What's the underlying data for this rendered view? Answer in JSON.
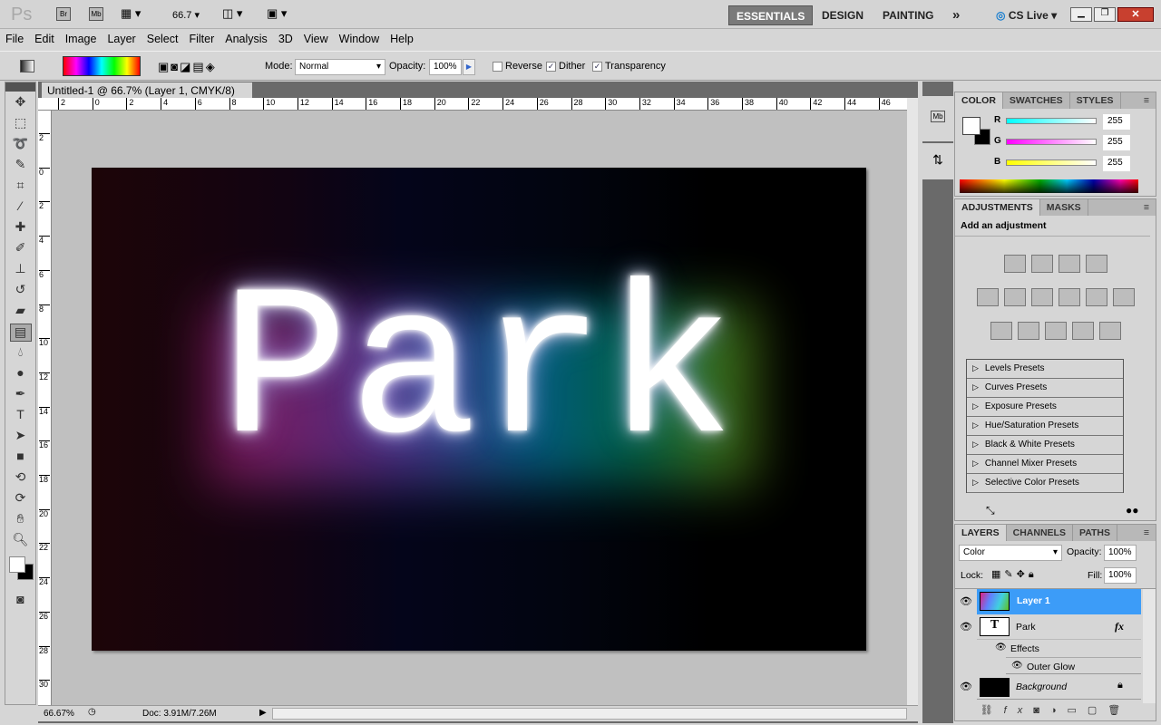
{
  "appbar": {
    "logo": "Ps",
    "bridge": "Br",
    "mini_bridge": "Mb",
    "zoom": "66.7",
    "workspaces": [
      "ESSENTIALS",
      "DESIGN",
      "PAINTING"
    ],
    "more": "»",
    "cs_live": "CS Live"
  },
  "menu": [
    "File",
    "Edit",
    "Image",
    "Layer",
    "Select",
    "Filter",
    "Analysis",
    "3D",
    "View",
    "Window",
    "Help"
  ],
  "options": {
    "mode_label": "Mode:",
    "mode_value": "Normal",
    "opacity_label": "Opacity:",
    "opacity_value": "100%",
    "reverse_label": "Reverse",
    "reverse_checked": false,
    "dither_label": "Dither",
    "dither_checked": true,
    "transparency_label": "Transparency",
    "transparency_checked": true
  },
  "document": {
    "tab_title": "Untitled-1 @ 66.7% (Layer 1, CMYK/8) *",
    "canvas_text": "Park",
    "ruler_top": [
      "2",
      "0",
      "2",
      "4",
      "6",
      "8",
      "10",
      "12",
      "14",
      "16",
      "18",
      "20",
      "22",
      "24",
      "26",
      "28",
      "30",
      "32",
      "34",
      "36",
      "38",
      "40",
      "42",
      "44",
      "46"
    ],
    "ruler_left": [
      "2",
      "0",
      "2",
      "4",
      "6",
      "8",
      "10",
      "12",
      "14",
      "16",
      "18",
      "20",
      "22",
      "24",
      "26",
      "28",
      "30"
    ]
  },
  "status": {
    "zoom": "66.67%",
    "doc": "Doc: 3.91M/7.26M"
  },
  "color_panel": {
    "tabs": [
      "COLOR",
      "SWATCHES",
      "STYLES"
    ],
    "channels": [
      {
        "label": "R",
        "value": "255"
      },
      {
        "label": "G",
        "value": "255"
      },
      {
        "label": "B",
        "value": "255"
      }
    ],
    "foreground": "#ffffff",
    "background": "#000000"
  },
  "adjustments_panel": {
    "tabs": [
      "ADJUSTMENTS",
      "MASKS"
    ],
    "heading": "Add an adjustment",
    "presets": [
      "Levels Presets",
      "Curves Presets",
      "Exposure Presets",
      "Hue/Saturation Presets",
      "Black & White Presets",
      "Channel Mixer Presets",
      "Selective Color Presets"
    ]
  },
  "layers_panel": {
    "tabs": [
      "LAYERS",
      "CHANNELS",
      "PATHS"
    ],
    "blend_mode": "Color",
    "opacity_label": "Opacity:",
    "opacity_value": "100%",
    "lock_label": "Lock:",
    "fill_label": "Fill:",
    "fill_value": "100%",
    "layers": [
      {
        "name": "Layer 1",
        "selected": true
      },
      {
        "name": "Park",
        "type": "text",
        "fx": "fx"
      },
      {
        "name": "Effects"
      },
      {
        "name": "Outer Glow"
      },
      {
        "name": "Background",
        "locked": true
      }
    ]
  }
}
